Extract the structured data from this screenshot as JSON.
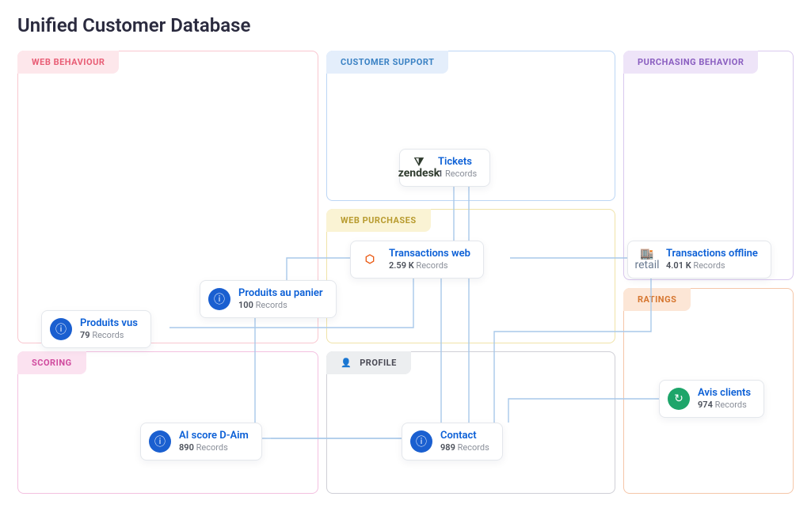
{
  "title": "Unified Customer Database",
  "records_suffix": "Records",
  "zones": {
    "web_behaviour": "WEB BEHAVIOUR",
    "customer_support": "CUSTOMER SUPPORT",
    "purchasing_behavior": "PURCHASING BEHAVIOR",
    "web_purchases": "WEB PURCHASES",
    "scoring": "SCORING",
    "profile": "PROFILE",
    "ratings": "RATINGS"
  },
  "nodes": {
    "tickets": {
      "name": "Tickets",
      "count": "1"
    },
    "transactions_web": {
      "name": "Transactions web",
      "count": "2.59 K"
    },
    "transactions_off": {
      "name": "Transactions offline",
      "count": "4.01 K"
    },
    "produits_panier": {
      "name": "Produits au panier",
      "count": "100"
    },
    "produits_vus": {
      "name": "Produits vus",
      "count": "79"
    },
    "ai_score": {
      "name": "AI score D-Aim",
      "count": "890"
    },
    "contact": {
      "name": "Contact",
      "count": "989"
    },
    "avis_clients": {
      "name": "Avis clients",
      "count": "974"
    }
  }
}
